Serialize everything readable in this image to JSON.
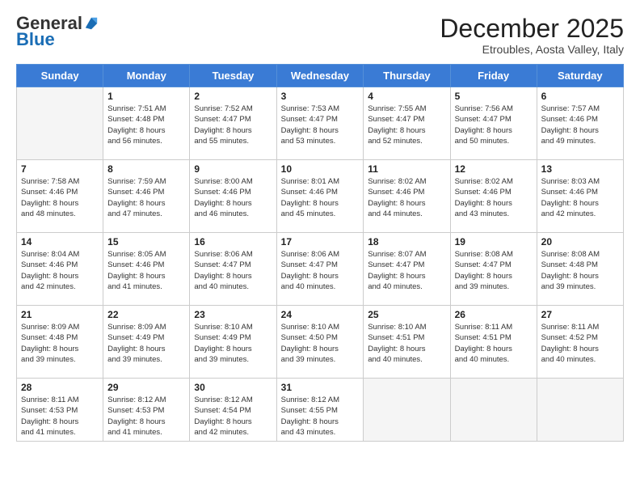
{
  "header": {
    "logo_general": "General",
    "logo_blue": "Blue",
    "month_title": "December 2025",
    "location": "Etroubles, Aosta Valley, Italy"
  },
  "weekdays": [
    "Sunday",
    "Monday",
    "Tuesday",
    "Wednesday",
    "Thursday",
    "Friday",
    "Saturday"
  ],
  "weeks": [
    [
      {
        "day": "",
        "info": ""
      },
      {
        "day": "1",
        "info": "Sunrise: 7:51 AM\nSunset: 4:48 PM\nDaylight: 8 hours\nand 56 minutes."
      },
      {
        "day": "2",
        "info": "Sunrise: 7:52 AM\nSunset: 4:47 PM\nDaylight: 8 hours\nand 55 minutes."
      },
      {
        "day": "3",
        "info": "Sunrise: 7:53 AM\nSunset: 4:47 PM\nDaylight: 8 hours\nand 53 minutes."
      },
      {
        "day": "4",
        "info": "Sunrise: 7:55 AM\nSunset: 4:47 PM\nDaylight: 8 hours\nand 52 minutes."
      },
      {
        "day": "5",
        "info": "Sunrise: 7:56 AM\nSunset: 4:47 PM\nDaylight: 8 hours\nand 50 minutes."
      },
      {
        "day": "6",
        "info": "Sunrise: 7:57 AM\nSunset: 4:46 PM\nDaylight: 8 hours\nand 49 minutes."
      }
    ],
    [
      {
        "day": "7",
        "info": "Sunrise: 7:58 AM\nSunset: 4:46 PM\nDaylight: 8 hours\nand 48 minutes."
      },
      {
        "day": "8",
        "info": "Sunrise: 7:59 AM\nSunset: 4:46 PM\nDaylight: 8 hours\nand 47 minutes."
      },
      {
        "day": "9",
        "info": "Sunrise: 8:00 AM\nSunset: 4:46 PM\nDaylight: 8 hours\nand 46 minutes."
      },
      {
        "day": "10",
        "info": "Sunrise: 8:01 AM\nSunset: 4:46 PM\nDaylight: 8 hours\nand 45 minutes."
      },
      {
        "day": "11",
        "info": "Sunrise: 8:02 AM\nSunset: 4:46 PM\nDaylight: 8 hours\nand 44 minutes."
      },
      {
        "day": "12",
        "info": "Sunrise: 8:02 AM\nSunset: 4:46 PM\nDaylight: 8 hours\nand 43 minutes."
      },
      {
        "day": "13",
        "info": "Sunrise: 8:03 AM\nSunset: 4:46 PM\nDaylight: 8 hours\nand 42 minutes."
      }
    ],
    [
      {
        "day": "14",
        "info": "Sunrise: 8:04 AM\nSunset: 4:46 PM\nDaylight: 8 hours\nand 42 minutes."
      },
      {
        "day": "15",
        "info": "Sunrise: 8:05 AM\nSunset: 4:46 PM\nDaylight: 8 hours\nand 41 minutes."
      },
      {
        "day": "16",
        "info": "Sunrise: 8:06 AM\nSunset: 4:47 PM\nDaylight: 8 hours\nand 40 minutes."
      },
      {
        "day": "17",
        "info": "Sunrise: 8:06 AM\nSunset: 4:47 PM\nDaylight: 8 hours\nand 40 minutes."
      },
      {
        "day": "18",
        "info": "Sunrise: 8:07 AM\nSunset: 4:47 PM\nDaylight: 8 hours\nand 40 minutes."
      },
      {
        "day": "19",
        "info": "Sunrise: 8:08 AM\nSunset: 4:47 PM\nDaylight: 8 hours\nand 39 minutes."
      },
      {
        "day": "20",
        "info": "Sunrise: 8:08 AM\nSunset: 4:48 PM\nDaylight: 8 hours\nand 39 minutes."
      }
    ],
    [
      {
        "day": "21",
        "info": "Sunrise: 8:09 AM\nSunset: 4:48 PM\nDaylight: 8 hours\nand 39 minutes."
      },
      {
        "day": "22",
        "info": "Sunrise: 8:09 AM\nSunset: 4:49 PM\nDaylight: 8 hours\nand 39 minutes."
      },
      {
        "day": "23",
        "info": "Sunrise: 8:10 AM\nSunset: 4:49 PM\nDaylight: 8 hours\nand 39 minutes."
      },
      {
        "day": "24",
        "info": "Sunrise: 8:10 AM\nSunset: 4:50 PM\nDaylight: 8 hours\nand 39 minutes."
      },
      {
        "day": "25",
        "info": "Sunrise: 8:10 AM\nSunset: 4:51 PM\nDaylight: 8 hours\nand 40 minutes."
      },
      {
        "day": "26",
        "info": "Sunrise: 8:11 AM\nSunset: 4:51 PM\nDaylight: 8 hours\nand 40 minutes."
      },
      {
        "day": "27",
        "info": "Sunrise: 8:11 AM\nSunset: 4:52 PM\nDaylight: 8 hours\nand 40 minutes."
      }
    ],
    [
      {
        "day": "28",
        "info": "Sunrise: 8:11 AM\nSunset: 4:53 PM\nDaylight: 8 hours\nand 41 minutes."
      },
      {
        "day": "29",
        "info": "Sunrise: 8:12 AM\nSunset: 4:53 PM\nDaylight: 8 hours\nand 41 minutes."
      },
      {
        "day": "30",
        "info": "Sunrise: 8:12 AM\nSunset: 4:54 PM\nDaylight: 8 hours\nand 42 minutes."
      },
      {
        "day": "31",
        "info": "Sunrise: 8:12 AM\nSunset: 4:55 PM\nDaylight: 8 hours\nand 43 minutes."
      },
      {
        "day": "",
        "info": ""
      },
      {
        "day": "",
        "info": ""
      },
      {
        "day": "",
        "info": ""
      }
    ]
  ]
}
